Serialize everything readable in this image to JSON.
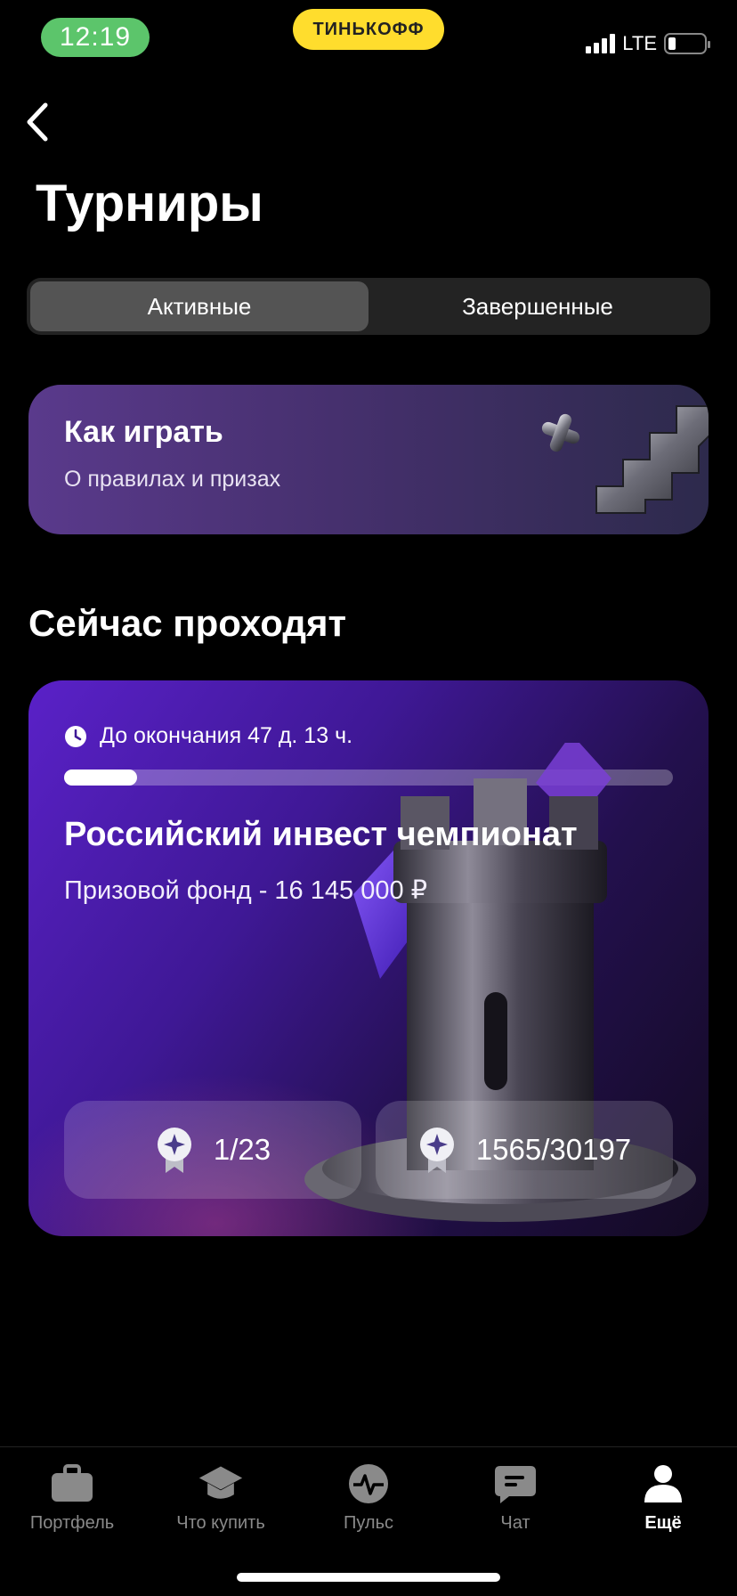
{
  "status_bar": {
    "time": "12:19",
    "network": "LTE",
    "brand": "ТИНЬКОФФ"
  },
  "page": {
    "title": "Турниры"
  },
  "segments": {
    "active": "Активные",
    "finished": "Завершенные"
  },
  "how_to": {
    "title": "Как играть",
    "subtitle": "О правилах и призах"
  },
  "section_title": "Сейчас проходят",
  "tournament": {
    "time_left": "До окончания 47 д. 13 ч.",
    "progress": 0.12,
    "title": "Российский инвест чемпионат",
    "prize": "Призовой фонд - 16 145 000 ₽",
    "stat_1": "1/23",
    "stat_2": "1565/30197"
  },
  "tabbar": {
    "items": [
      {
        "label": "Портфель",
        "icon": "briefcase-icon"
      },
      {
        "label": "Что купить",
        "icon": "graduation-cap-icon"
      },
      {
        "label": "Пульс",
        "icon": "pulse-icon"
      },
      {
        "label": "Чат",
        "icon": "chat-icon"
      },
      {
        "label": "Ещё",
        "icon": "profile-icon"
      }
    ],
    "active_index": 4
  },
  "colors": {
    "accent": "#5a21c8",
    "brand_yellow": "#ffdd2d",
    "status_green": "#5cc56b"
  }
}
